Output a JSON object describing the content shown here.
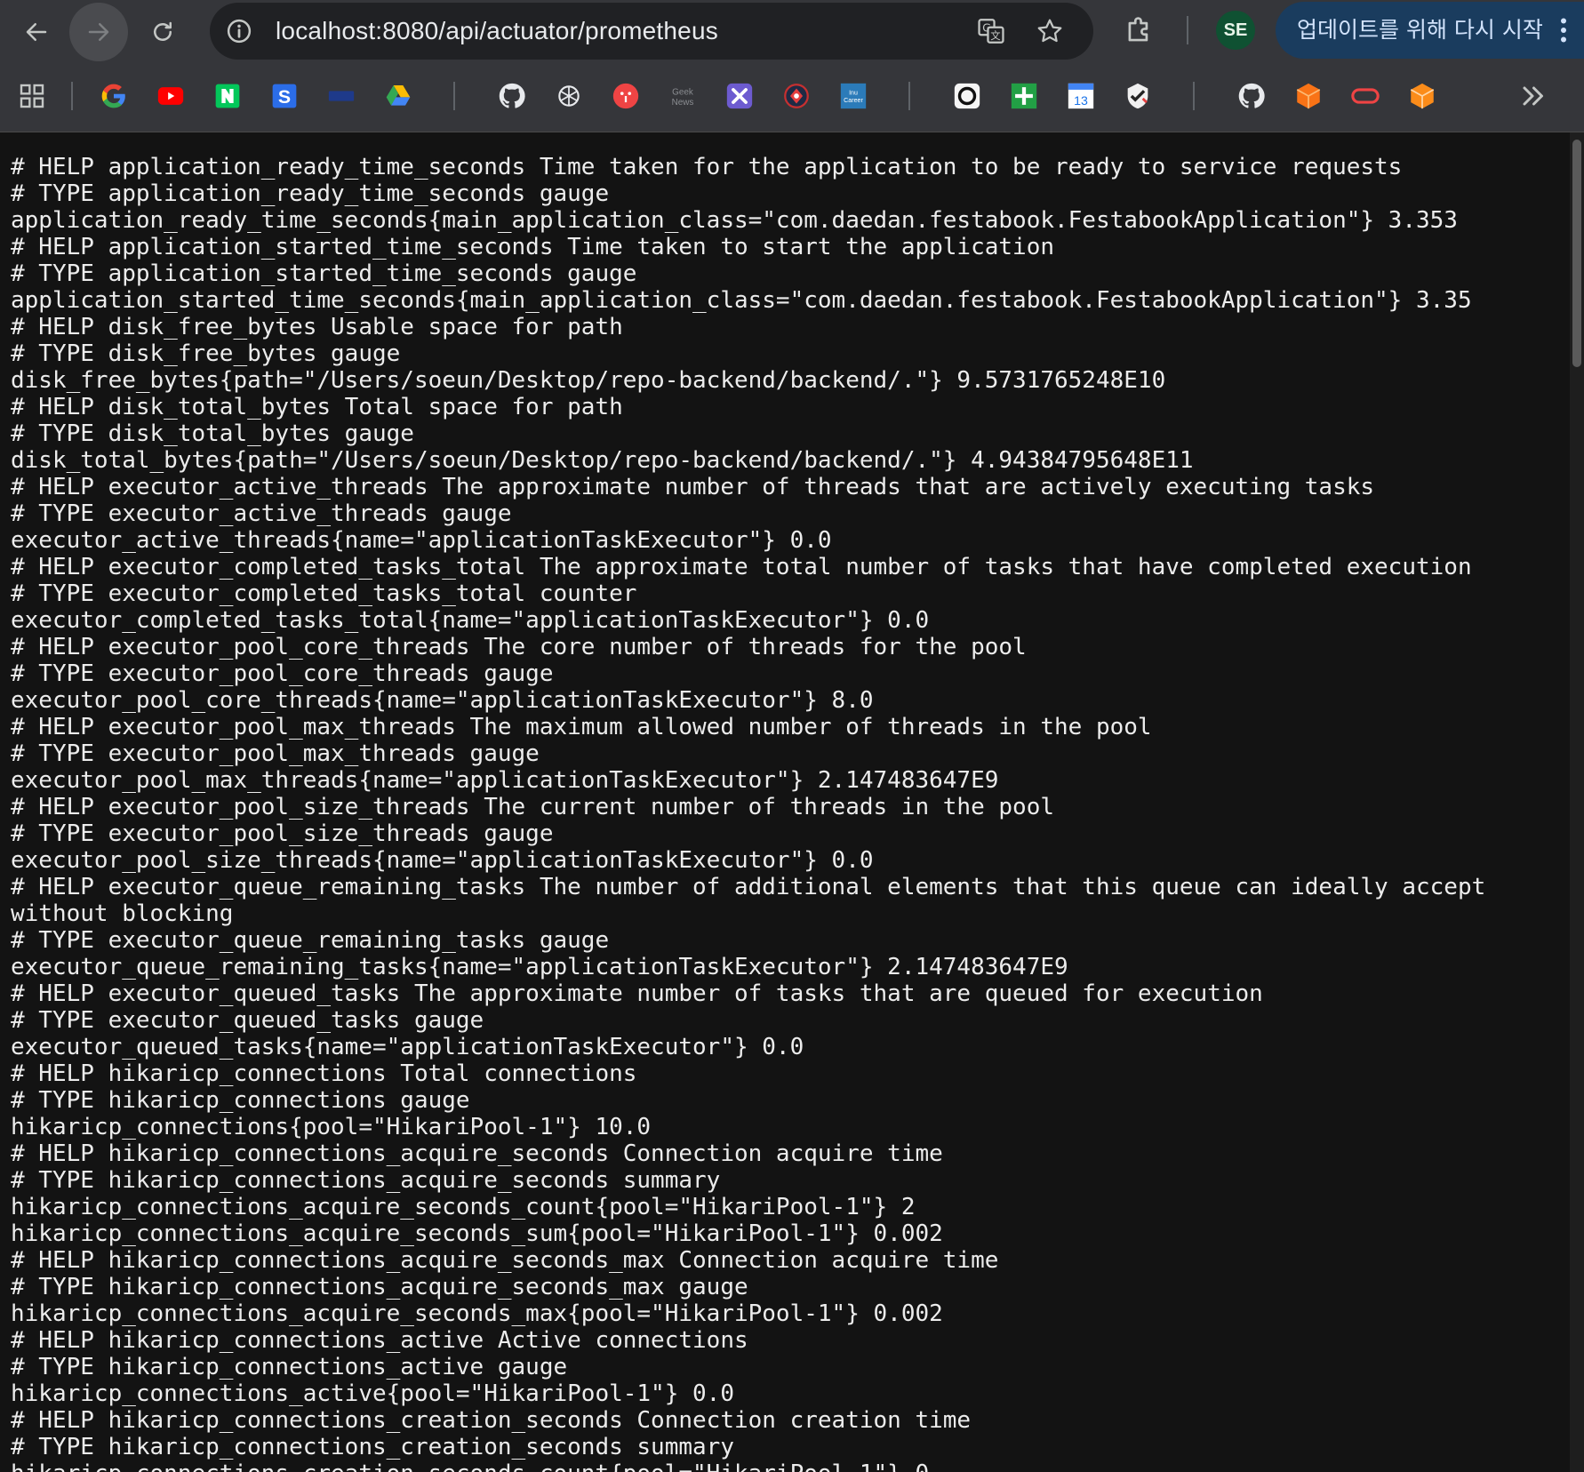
{
  "browser": {
    "url": "localhost:8080/api/actuator/prometheus",
    "profile_initials": "SE",
    "update_button_label": "업데이트를 위해 다시 시작",
    "icons": {
      "back": "arrow-left-icon",
      "forward": "arrow-right-icon",
      "reload": "reload-icon",
      "site_info": "info-circle-icon",
      "translate": "translate-icon",
      "bookmark_star": "star-icon",
      "extensions": "puzzle-icon",
      "menu": "vertical-dots-icon"
    },
    "accent_colors": {
      "toolbar": "#35363a",
      "omnibox": "#202124",
      "update_button": "#1a3c5e",
      "avatar": "#0f5132"
    }
  },
  "bookmarks": {
    "items": [
      {
        "name": "apps-grid-icon"
      },
      {
        "name": "google-icon"
      },
      {
        "name": "youtube-icon"
      },
      {
        "name": "naver-icon",
        "text": "N"
      },
      {
        "name": "s-app-icon",
        "text": "S"
      },
      {
        "name": "flag-icon"
      },
      {
        "name": "google-drive-icon"
      },
      {
        "name": "github-icon"
      },
      {
        "name": "openai-icon"
      },
      {
        "name": "red-circle-icon"
      },
      {
        "name": "geeknews-icon",
        "text": "Geek News"
      },
      {
        "name": "x-tools-icon"
      },
      {
        "name": "globe-badge-icon"
      },
      {
        "name": "inu-career-icon",
        "text": "Inu Career"
      },
      {
        "name": "screen-capture-icon"
      },
      {
        "name": "green-plus-icon"
      },
      {
        "name": "calendar-icon",
        "text": "13"
      },
      {
        "name": "check-shield-icon"
      },
      {
        "name": "github-icon-2"
      },
      {
        "name": "orange-cube-icon"
      },
      {
        "name": "red-pill-icon"
      },
      {
        "name": "orange-cube-icon-2"
      }
    ],
    "more_icon": "double-chevron-right-icon"
  },
  "content": {
    "lines": [
      "# HELP application_ready_time_seconds Time taken for the application to be ready to service requests",
      "# TYPE application_ready_time_seconds gauge",
      "application_ready_time_seconds{main_application_class=\"com.daedan.festabook.FestabookApplication\"} 3.353",
      "# HELP application_started_time_seconds Time taken to start the application",
      "# TYPE application_started_time_seconds gauge",
      "application_started_time_seconds{main_application_class=\"com.daedan.festabook.FestabookApplication\"} 3.35",
      "# HELP disk_free_bytes Usable space for path",
      "# TYPE disk_free_bytes gauge",
      "disk_free_bytes{path=\"/Users/soeun/Desktop/repo-backend/backend/.\"} 9.5731765248E10",
      "# HELP disk_total_bytes Total space for path",
      "# TYPE disk_total_bytes gauge",
      "disk_total_bytes{path=\"/Users/soeun/Desktop/repo-backend/backend/.\"} 4.94384795648E11",
      "# HELP executor_active_threads The approximate number of threads that are actively executing tasks",
      "# TYPE executor_active_threads gauge",
      "executor_active_threads{name=\"applicationTaskExecutor\"} 0.0",
      "# HELP executor_completed_tasks_total The approximate total number of tasks that have completed execution",
      "# TYPE executor_completed_tasks_total counter",
      "executor_completed_tasks_total{name=\"applicationTaskExecutor\"} 0.0",
      "# HELP executor_pool_core_threads The core number of threads for the pool",
      "# TYPE executor_pool_core_threads gauge",
      "executor_pool_core_threads{name=\"applicationTaskExecutor\"} 8.0",
      "# HELP executor_pool_max_threads The maximum allowed number of threads in the pool",
      "# TYPE executor_pool_max_threads gauge",
      "executor_pool_max_threads{name=\"applicationTaskExecutor\"} 2.147483647E9",
      "# HELP executor_pool_size_threads The current number of threads in the pool",
      "# TYPE executor_pool_size_threads gauge",
      "executor_pool_size_threads{name=\"applicationTaskExecutor\"} 0.0",
      "# HELP executor_queue_remaining_tasks The number of additional elements that this queue can ideally accept without blocking",
      "# TYPE executor_queue_remaining_tasks gauge",
      "executor_queue_remaining_tasks{name=\"applicationTaskExecutor\"} 2.147483647E9",
      "# HELP executor_queued_tasks The approximate number of tasks that are queued for execution",
      "# TYPE executor_queued_tasks gauge",
      "executor_queued_tasks{name=\"applicationTaskExecutor\"} 0.0",
      "# HELP hikaricp_connections Total connections",
      "# TYPE hikaricp_connections gauge",
      "hikaricp_connections{pool=\"HikariPool-1\"} 10.0",
      "# HELP hikaricp_connections_acquire_seconds Connection acquire time",
      "# TYPE hikaricp_connections_acquire_seconds summary",
      "hikaricp_connections_acquire_seconds_count{pool=\"HikariPool-1\"} 2",
      "hikaricp_connections_acquire_seconds_sum{pool=\"HikariPool-1\"} 0.002",
      "# HELP hikaricp_connections_acquire_seconds_max Connection acquire time",
      "# TYPE hikaricp_connections_acquire_seconds_max gauge",
      "hikaricp_connections_acquire_seconds_max{pool=\"HikariPool-1\"} 0.002",
      "# HELP hikaricp_connections_active Active connections",
      "# TYPE hikaricp_connections_active gauge",
      "hikaricp_connections_active{pool=\"HikariPool-1\"} 0.0",
      "# HELP hikaricp_connections_creation_seconds Connection creation time",
      "# TYPE hikaricp_connections_creation_seconds summary",
      "hikaricp_connections_creation_seconds_count{pool=\"HikariPool-1\"} 0"
    ]
  }
}
